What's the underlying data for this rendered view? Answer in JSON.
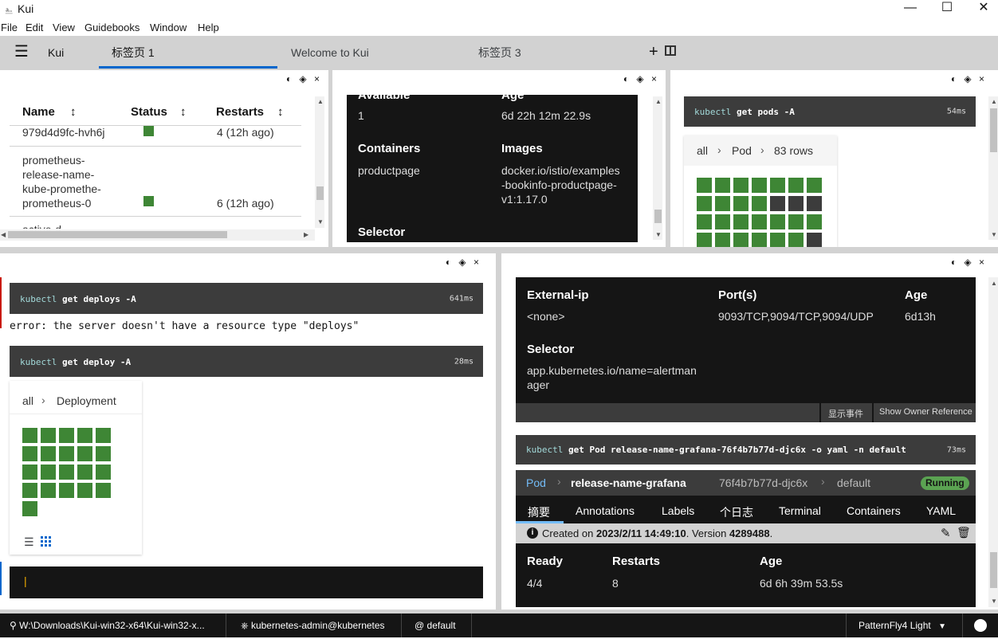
{
  "window": {
    "title": "Kui",
    "controls": {
      "minimize": "—",
      "maximize": "☐",
      "close": "✕"
    }
  },
  "menu": [
    "File",
    "Edit",
    "View",
    "Guidebooks",
    "Window",
    "Help"
  ],
  "tabs": {
    "brand": "Kui",
    "items": [
      "标签页 1",
      "Welcome to Kui",
      "标签页 3"
    ],
    "active": 0
  },
  "pane1": {
    "columns": [
      "Name",
      "Status",
      "Restarts"
    ],
    "rows": [
      {
        "name": "979d4d9fc-hvh6j",
        "restarts": "4 (12h ago)"
      },
      {
        "name": "prometheus-release-name-kube-promethe-prometheus-0",
        "name_lines": [
          "prometheus-",
          "release-name-",
          "kube-promethe-",
          "prometheus-0"
        ],
        "restarts": "6 (12h ago)"
      }
    ],
    "cut_row": "active-d"
  },
  "pane2": {
    "top_left_label": "Available",
    "top_right_label": "Age",
    "available": "1",
    "age": "6d 22h 12m 22.9s",
    "containers_label": "Containers",
    "images_label": "Images",
    "container": "productpage",
    "image_lines": [
      "docker.io/istio/examples",
      "-bookinfo-productpage-",
      "v1:1.17.0"
    ],
    "selector_label": "Selector"
  },
  "pane3": {
    "cmd_kw": "kubectl",
    "cmd_rest": "get pods -A",
    "time": "54ms",
    "breadcrumb": [
      "all",
      "Pod",
      "83 rows"
    ]
  },
  "pane4": {
    "cmd1_kw": "kubectl",
    "cmd1_rest": "get deploys -A",
    "cmd1_time": "641ms",
    "error": "error: the server doesn't have a resource type \"deploys\"",
    "cmd2_kw": "kubectl",
    "cmd2_rest": "get deploy -A",
    "cmd2_time": "28ms",
    "breadcrumb": [
      "all",
      "Deployment"
    ],
    "prompt_cursor": "|"
  },
  "pane5": {
    "external_ip_label": "External-ip",
    "external_ip": "<none>",
    "ports_label": "Port(s)",
    "ports": "9093/TCP,9094/TCP,9094/UDP",
    "age_label": "Age",
    "age": "6d13h",
    "selector_label": "Selector",
    "selector_lines": [
      "app.kubernetes.io/name=alertman",
      "ager"
    ],
    "btn_events": "显示事件",
    "btn_owner": "Show Owner Reference",
    "cmd_kw": "kubectl",
    "cmd_rest": "get Pod release-name-grafana-76f4b7b77d-djc6x -o yaml -n default",
    "cmd_time": "73ms",
    "kind": "Pod",
    "name": "release-name-grafana",
    "suffix": "76f4b7b77d-djc6x",
    "namespace": "default",
    "status": "Running",
    "subtabs": [
      "摘要",
      "Annotations",
      "Labels",
      "个日志",
      "Terminal",
      "Containers",
      "YAML"
    ],
    "created_prefix": "Created on",
    "created_at": "2023/2/11 14:49:10",
    "version_prefix": ". Version",
    "version": "4289488",
    "version_suffix": ".",
    "ready_label": "Ready",
    "ready": "4/4",
    "restarts_label": "Restarts",
    "restarts": "8",
    "age2_label": "Age",
    "age2": "6d 6h 39m 53.5s"
  },
  "footer": {
    "path": "W:\\Downloads\\Kui-win32-x64\\Kui-win32-x...",
    "context": "kubernetes-admin@kubernetes",
    "namespace": "default",
    "theme": "PatternFly4 Light"
  },
  "colors": {
    "accent": "#0066cc",
    "ok": "#3e8635",
    "dark": "#151515"
  }
}
